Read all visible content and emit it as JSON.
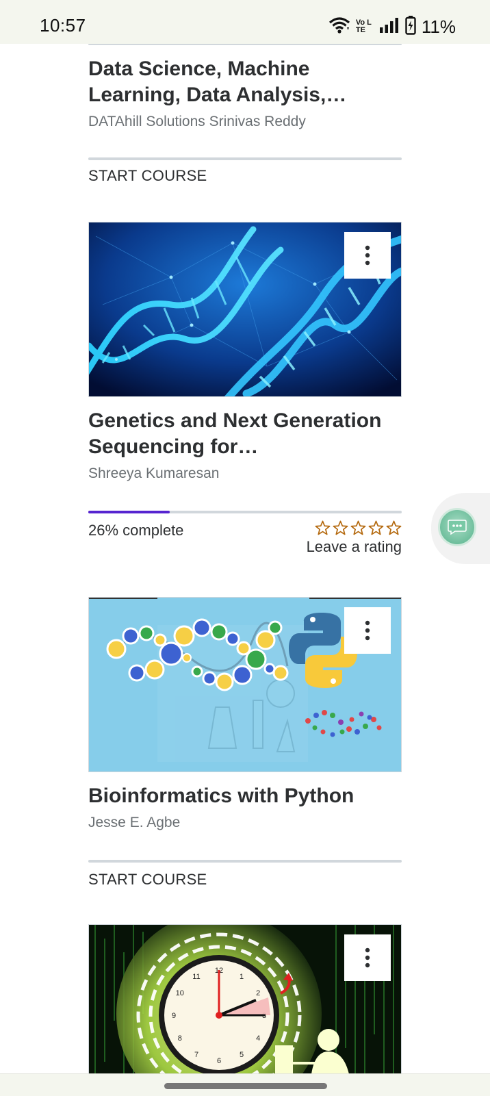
{
  "status_bar": {
    "time": "10:57",
    "network_label": "Vo LTE",
    "battery": "11%",
    "icons": [
      "wifi-icon",
      "volte-icon",
      "signal-icon",
      "battery-icon"
    ]
  },
  "courses": [
    {
      "title": "Data Science, Machine Learning, Data Analysis,…",
      "title_lines": [
        "Data Science, Machine",
        "Learning, Data Analysis,…"
      ],
      "author": "DATAhill Solutions Srinivas Reddy",
      "action": "START COURSE"
    },
    {
      "title_lines": [
        "Genetics and Next Generation",
        "Sequencing for…"
      ],
      "author": "Shreeya Kumaresan",
      "progress_percent": 26,
      "progress_text": "26% complete",
      "rating_label": "Leave a rating",
      "rating_stars": 0,
      "stars_total": 5
    },
    {
      "title_lines": [
        "Bioinformatics with Python"
      ],
      "author": "Jesse E. Agbe",
      "action": "START COURSE"
    },
    {
      "thumbnail": "clock-dna-thumbnail"
    }
  ],
  "colors": {
    "accent_progress": "#5624d0",
    "star": "#b4690e",
    "divider": "#d1d7dc",
    "text_primary": "#2d2f31",
    "text_secondary": "#6a6f73"
  },
  "clock_numbers": [
    "12",
    "1",
    "2",
    "3",
    "4",
    "5",
    "6",
    "7",
    "8",
    "9",
    "10",
    "11"
  ]
}
